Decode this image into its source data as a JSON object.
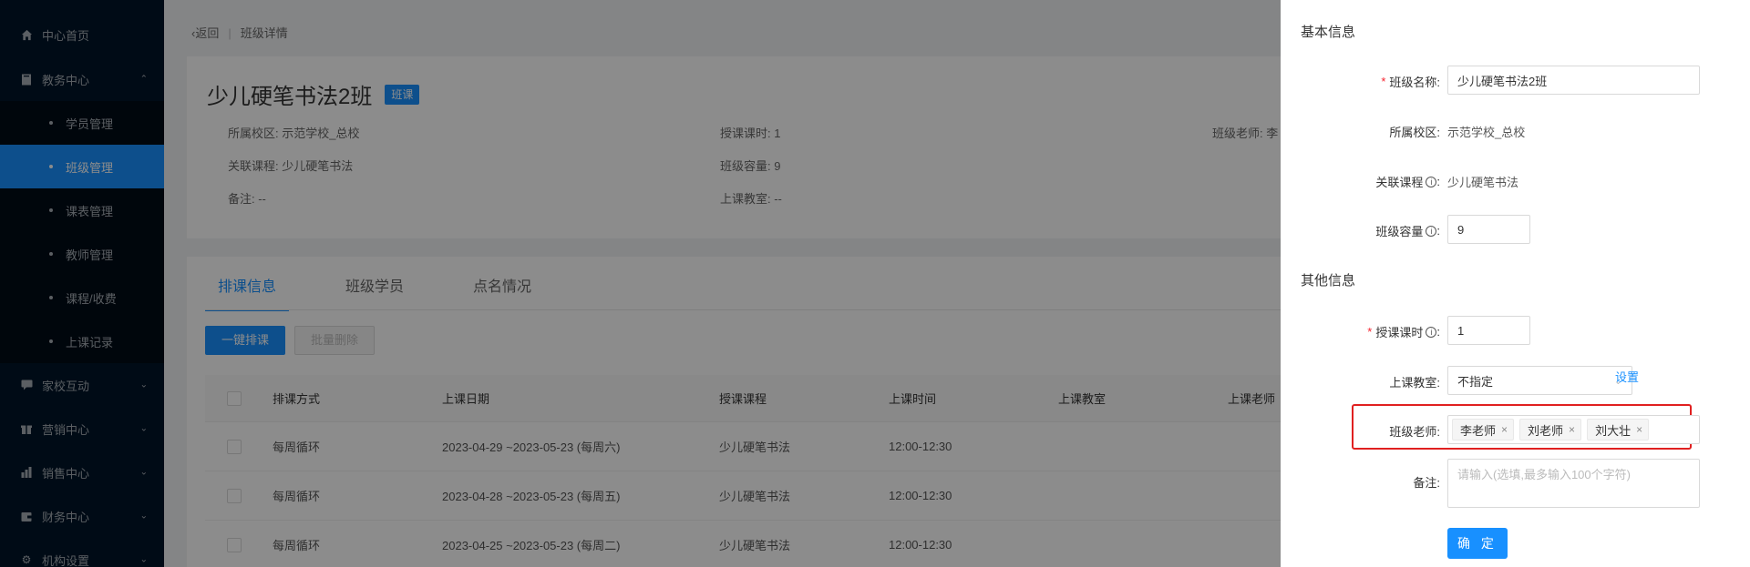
{
  "sidebar": {
    "items": [
      {
        "label": "中心首页",
        "icon": "home-icon"
      },
      {
        "label": "教务中心",
        "icon": "book-icon",
        "expanded": true
      },
      {
        "label": "家校互动",
        "icon": "chat-icon"
      },
      {
        "label": "营销中心",
        "icon": "gift-icon"
      },
      {
        "label": "销售中心",
        "icon": "chart-icon"
      },
      {
        "label": "财务中心",
        "icon": "wallet-icon"
      },
      {
        "label": "机构设置",
        "icon": "gear-icon"
      }
    ],
    "sub_items": [
      {
        "label": "学员管理"
      },
      {
        "label": "班级管理",
        "active": true
      },
      {
        "label": "课表管理"
      },
      {
        "label": "教师管理"
      },
      {
        "label": "课程/收费"
      },
      {
        "label": "上课记录"
      }
    ]
  },
  "breadcrumb": {
    "back": "返回",
    "current": "班级详情"
  },
  "class_header": {
    "name": "少儿硬笔书法2班",
    "tag": "班课",
    "info": {
      "campus": "所属校区: 示范学校_总校",
      "hours": "授课课时: 1",
      "teacher": "班级老师: 李",
      "course": "关联课程: 少儿硬笔书法",
      "capacity": "班级容量: 9",
      "remark": "备注: --",
      "classroom": "上课教室: --"
    }
  },
  "tabs": [
    {
      "label": "排课信息",
      "active": true
    },
    {
      "label": "班级学员"
    },
    {
      "label": "点名情况"
    }
  ],
  "actions": {
    "schedule": "一键排课",
    "batch_delete": "批量删除"
  },
  "table": {
    "headers": [
      "排课方式",
      "上课日期",
      "授课课程",
      "上课时间",
      "上课教室",
      "上课老师"
    ],
    "rows": [
      [
        "每周循环",
        "2023-04-29 ~2023-05-23 (每周六)",
        "少儿硬笔书法",
        "12:00-12:30",
        "",
        ""
      ],
      [
        "每周循环",
        "2023-04-28 ~2023-05-23 (每周五)",
        "少儿硬笔书法",
        "12:00-12:30",
        "",
        ""
      ],
      [
        "每周循环",
        "2023-04-25 ~2023-05-23 (每周二)",
        "少儿硬笔书法",
        "12:00-12:30",
        "",
        ""
      ]
    ]
  },
  "drawer": {
    "basic_title": "基本信息",
    "other_title": "其他信息",
    "fields": {
      "class_name_label": "班级名称:",
      "class_name_value": "少儿硬笔书法2班",
      "campus_label": "所属校区:",
      "campus_value": "示范学校_总校",
      "course_label": "关联课程",
      "course_value": "少儿硬笔书法",
      "capacity_label": "班级容量",
      "capacity_value": "9",
      "hours_label": "授课课时",
      "hours_value": "1",
      "classroom_label": "上课教室:",
      "classroom_value": "不指定",
      "classroom_link": "设置",
      "teachers_label": "班级老师:",
      "teachers": [
        "李老师",
        "刘老师",
        "刘大壮"
      ],
      "remark_label": "备注:",
      "remark_placeholder": "请输入(选填,最多输入100个字符)"
    },
    "confirm": "确 定",
    "colon": ":"
  }
}
